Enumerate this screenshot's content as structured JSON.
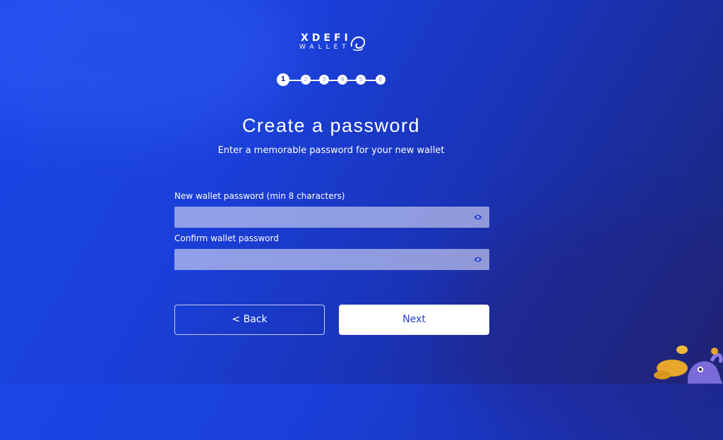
{
  "logo": {
    "line1": "XDEFI",
    "line2": "WALLET"
  },
  "steps": [
    {
      "number": "1",
      "active": true
    },
    {
      "number": "2",
      "active": false
    },
    {
      "number": "3",
      "active": false
    },
    {
      "number": "4",
      "active": false
    },
    {
      "number": "5",
      "active": false
    },
    {
      "number": "6",
      "active": false
    }
  ],
  "heading": "Create a password",
  "subtitle": "Enter a memorable password for your new wallet",
  "form": {
    "password_label": "New wallet password (min 8 characters)",
    "password_value": "",
    "confirm_label": "Confirm wallet password",
    "confirm_value": ""
  },
  "buttons": {
    "back": "< Back",
    "next": "Next"
  },
  "icons": {
    "toggle_visibility": "eye-icon",
    "logo_mark": "octopus-icon"
  },
  "colors": {
    "accent": "#2741c8",
    "background": "#1b3fd8"
  }
}
